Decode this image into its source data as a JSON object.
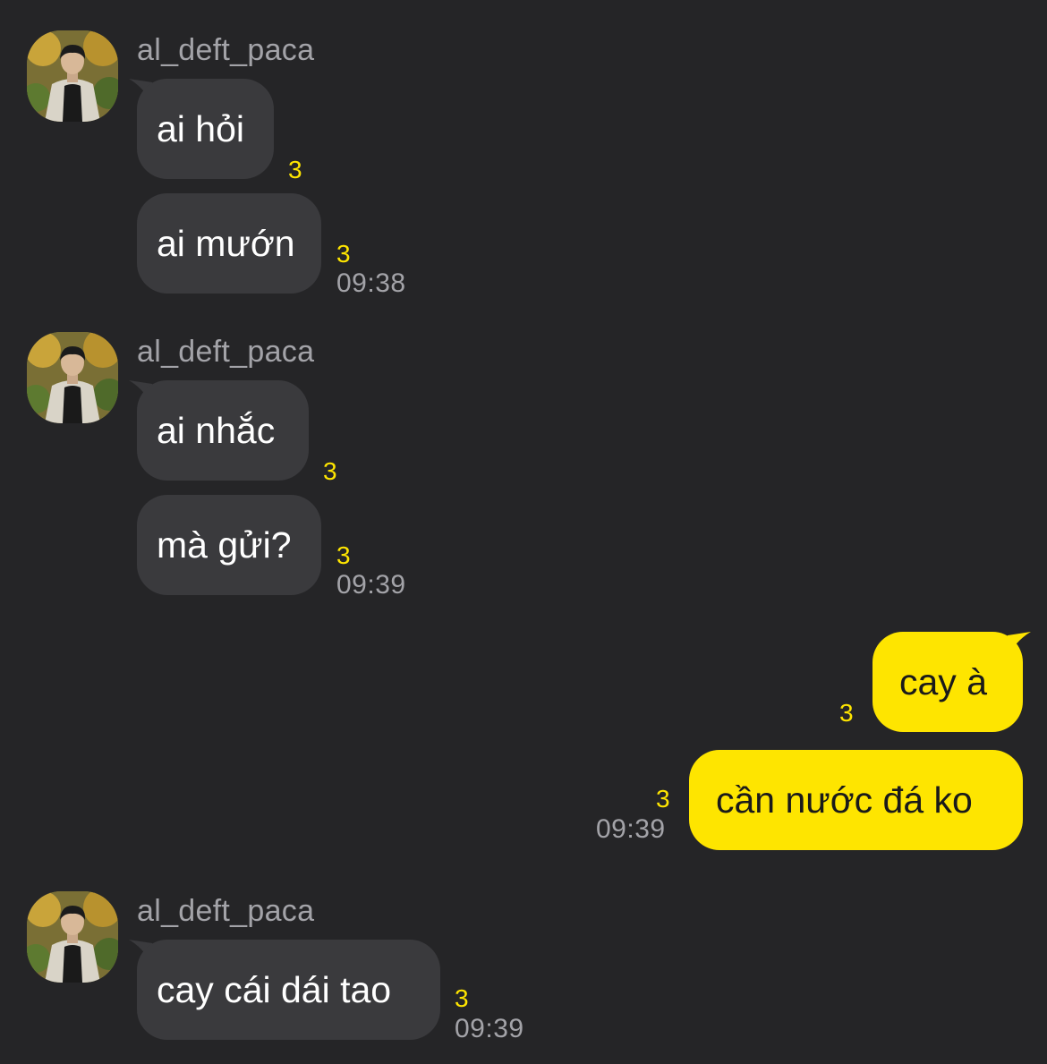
{
  "groups": [
    {
      "sender": "al_deft_paca",
      "messages": [
        {
          "text": "ai hỏi",
          "unread": "3"
        },
        {
          "text": "ai mướn",
          "unread": "3",
          "time": "09:38"
        }
      ]
    },
    {
      "sender": "al_deft_paca",
      "messages": [
        {
          "text": "ai nhắc",
          "unread": "3"
        },
        {
          "text": "mà gửi?",
          "unread": "3",
          "time": "09:39"
        }
      ]
    },
    {
      "sender": "me",
      "messages": [
        {
          "text": "cay à",
          "unread": "3"
        },
        {
          "text": "cần nước đá ko",
          "unread": "3",
          "time": "09:39"
        }
      ]
    },
    {
      "sender": "al_deft_paca",
      "messages": [
        {
          "text": "cay cái dái tao",
          "unread": "3",
          "time": "09:39"
        }
      ]
    }
  ],
  "colors": {
    "background": "#252527",
    "incoming_bubble": "#3a3a3d",
    "outgoing_bubble": "#fee500",
    "unread_count": "#fee500",
    "meta_text": "#a3a3a8"
  }
}
